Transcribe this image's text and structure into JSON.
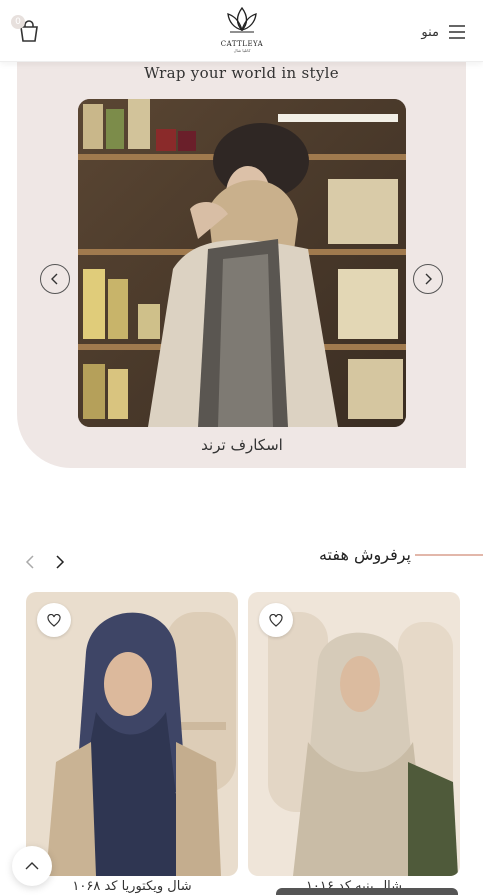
{
  "header": {
    "cart_count": "0",
    "logo_text": "CATTLEYA",
    "logo_sub": "کاتلیا شال",
    "menu_label": "منو"
  },
  "hero": {
    "title": "Wrap your world in style",
    "slide_caption": "اسکارف ترند"
  },
  "bestsellers": {
    "title": "پرفروش هفته"
  },
  "products": [
    {
      "title": "شال ویکتوریا کد ۱۰۶۸"
    },
    {
      "title": "شال پنبه کد ۱۰۱۶"
    }
  ],
  "icons": {
    "cart": "shopping-bag-icon",
    "menu": "hamburger-icon",
    "favorite": "heart-icon",
    "prev": "chevron-left-icon",
    "next": "chevron-right-icon",
    "top": "chevron-up-icon"
  },
  "colors": {
    "hero_bg": "#efe7e5",
    "accent_line": "#e2b7aa"
  }
}
